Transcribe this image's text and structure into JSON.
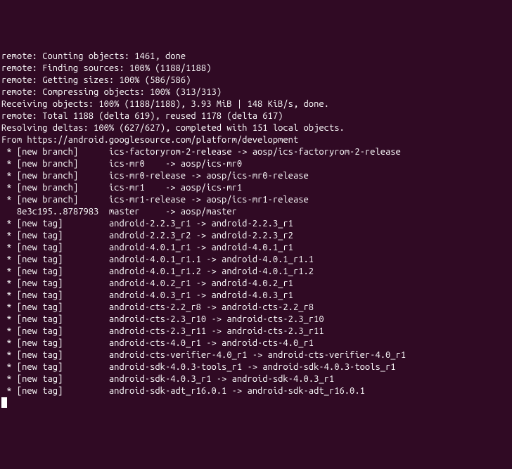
{
  "terminal": {
    "lines": [
      "remote: Counting objects: 1461, done",
      "remote: Finding sources: 100% (1188/1188)",
      "remote: Getting sizes: 100% (586/586)",
      "remote: Compressing objects: 100% (313/313)",
      "Receiving objects: 100% (1188/1188), 3.93 MiB | 148 KiB/s, done.",
      "remote: Total 1188 (delta 619), reused 1178 (delta 617)",
      "Resolving deltas: 100% (627/627), completed with 151 local objects.",
      "From https://android.googlesource.com/platform/development",
      " * [new branch]      ics-factoryrom-2-release -> aosp/ics-factoryrom-2-release",
      " * [new branch]      ics-mr0    -> aosp/ics-mr0",
      " * [new branch]      ics-mr0-release -> aosp/ics-mr0-release",
      " * [new branch]      ics-mr1    -> aosp/ics-mr1",
      " * [new branch]      ics-mr1-release -> aosp/ics-mr1-release",
      "   8e3c195..8787983  master     -> aosp/master",
      " * [new tag]         android-2.2.3_r1 -> android-2.2.3_r1",
      " * [new tag]         android-2.2.3_r2 -> android-2.2.3_r2",
      " * [new tag]         android-4.0.1_r1 -> android-4.0.1_r1",
      " * [new tag]         android-4.0.1_r1.1 -> android-4.0.1_r1.1",
      " * [new tag]         android-4.0.1_r1.2 -> android-4.0.1_r1.2",
      " * [new tag]         android-4.0.2_r1 -> android-4.0.2_r1",
      " * [new tag]         android-4.0.3_r1 -> android-4.0.3_r1",
      " * [new tag]         android-cts-2.2_r8 -> android-cts-2.2_r8",
      " * [new tag]         android-cts-2.3_r10 -> android-cts-2.3_r10",
      " * [new tag]         android-cts-2.3_r11 -> android-cts-2.3_r11",
      " * [new tag]         android-cts-4.0_r1 -> android-cts-4.0_r1",
      " * [new tag]         android-cts-verifier-4.0_r1 -> android-cts-verifier-4.0_r1",
      " * [new tag]         android-sdk-4.0.3-tools_r1 -> android-sdk-4.0.3-tools_r1",
      " * [new tag]         android-sdk-4.0.3_r1 -> android-sdk-4.0.3_r1",
      " * [new tag]         android-sdk-adt_r16.0.1 -> android-sdk-adt_r16.0.1"
    ]
  }
}
